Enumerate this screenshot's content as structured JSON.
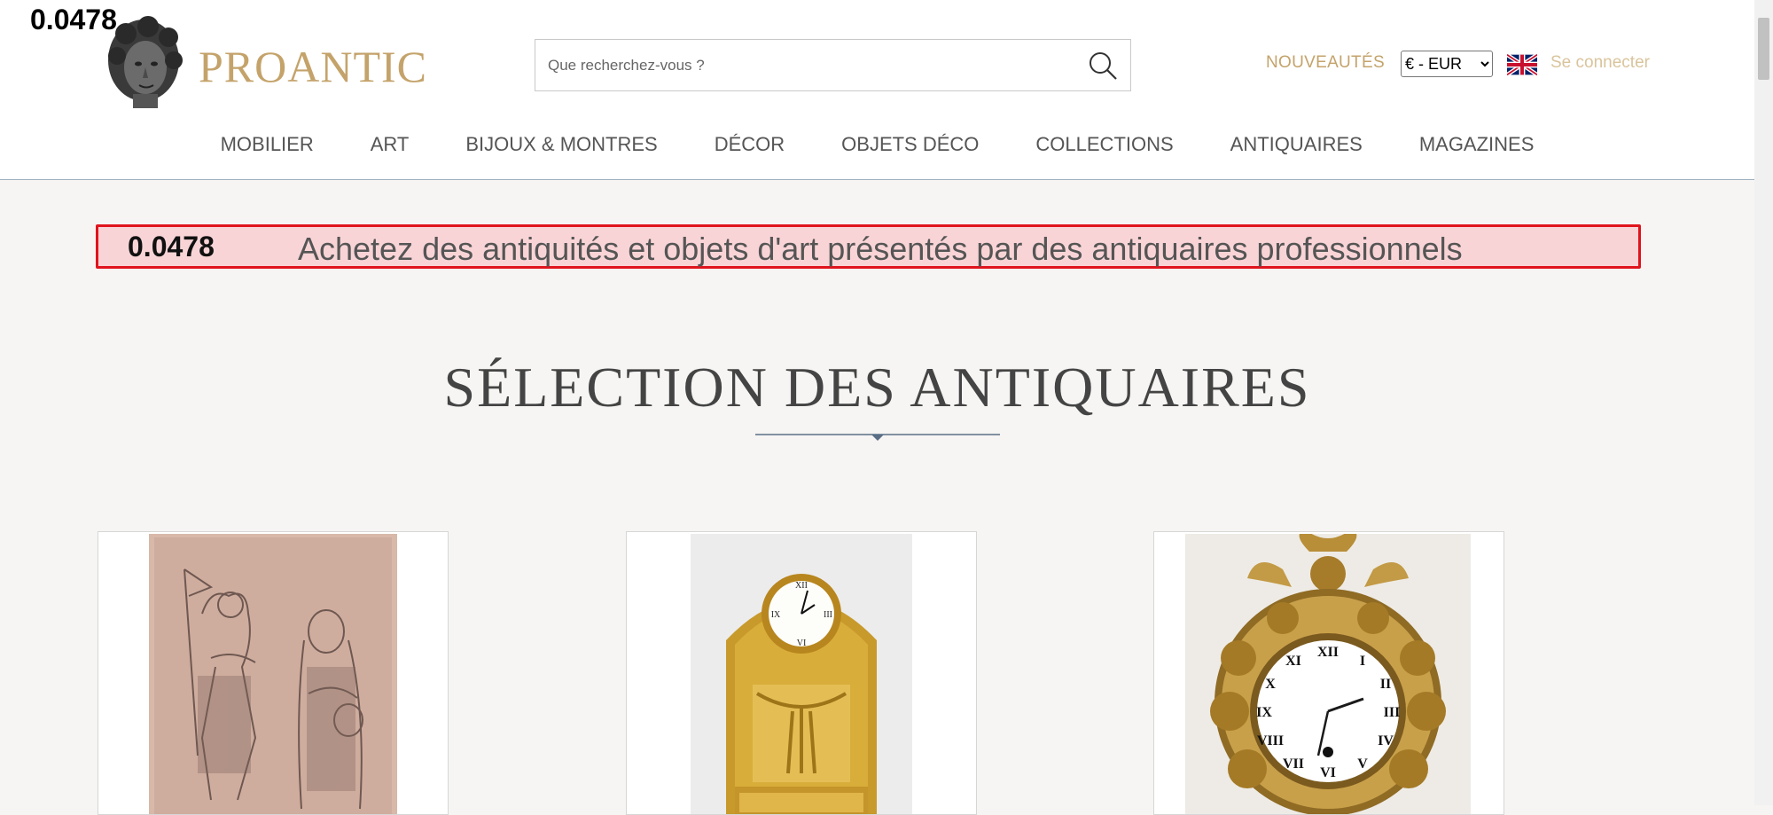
{
  "overlay": {
    "top_score": "0.0478"
  },
  "header": {
    "logo_text": "PROANTIC",
    "search": {
      "placeholder": "Que recherchez-vous ?",
      "value": ""
    },
    "new_items_label": "NOUVEAUTÉS",
    "currency": {
      "selected": "€ - EUR",
      "options": [
        "€ - EUR"
      ]
    },
    "language_flag": "uk-flag-icon",
    "login_label": "Se connecter"
  },
  "nav": {
    "items": [
      {
        "label": "MOBILIER"
      },
      {
        "label": "ART"
      },
      {
        "label": "BIJOUX & MONTRES"
      },
      {
        "label": "DÉCOR"
      },
      {
        "label": "OBJETS DÉCO"
      },
      {
        "label": "COLLECTIONS"
      },
      {
        "label": "ANTIQUAIRES"
      },
      {
        "label": "MAGAZINES"
      }
    ]
  },
  "banner": {
    "score": "0.0478",
    "text": "Achetez des antiquités et objets d'art présentés par des antiquaires professionnels"
  },
  "section": {
    "title": "SÉLECTION DES ANTIQUAIRES"
  },
  "products": [
    {
      "image": "sepia-drawing-two-saints"
    },
    {
      "image": "gilt-bronze-mantel-clock"
    },
    {
      "image": "gilt-bronze-cartel-clock"
    }
  ],
  "colors": {
    "gold_accent": "#c4a36b",
    "banner_bg": "#f9d4d6",
    "banner_border": "#e0141d",
    "page_bg": "#f6f5f3"
  }
}
